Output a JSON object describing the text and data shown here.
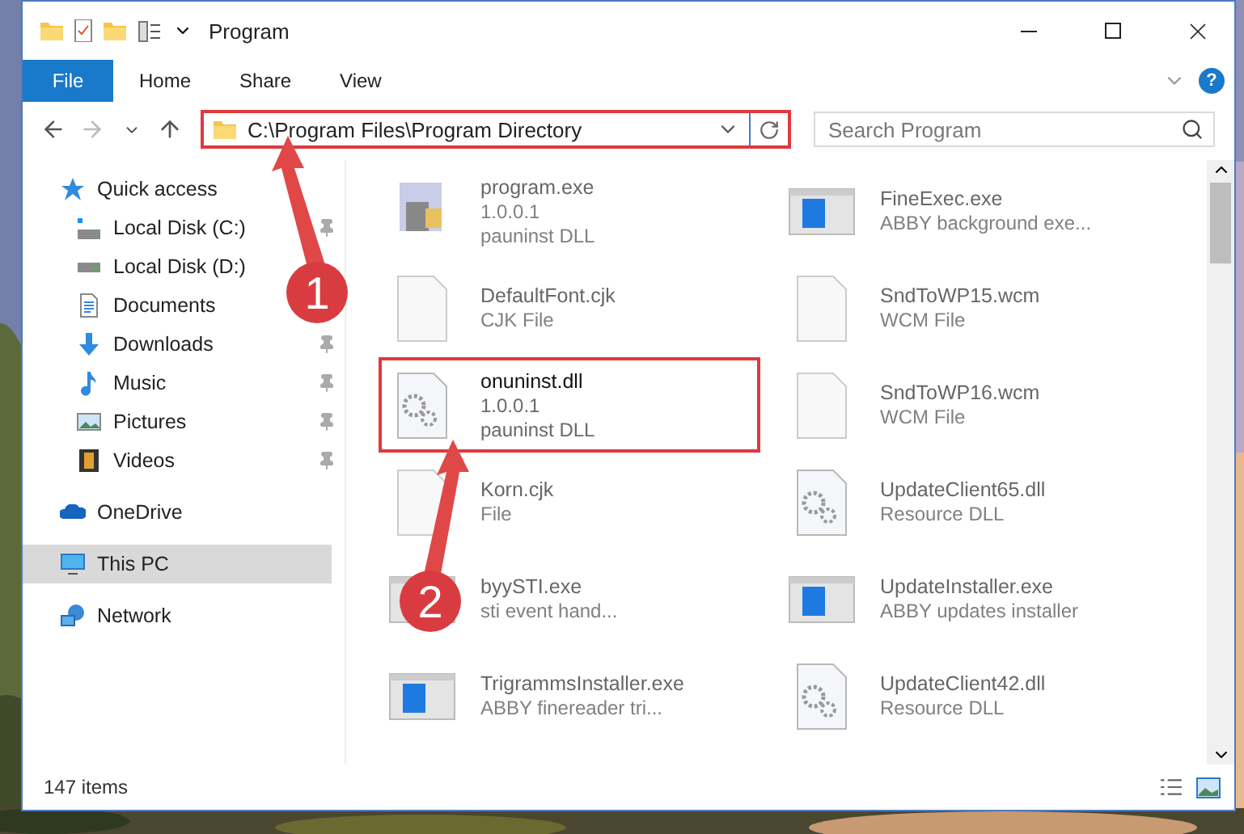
{
  "window": {
    "title": "Program"
  },
  "ribbon": {
    "file_button": "File",
    "tabs": [
      {
        "label": "Home",
        "selected": false
      },
      {
        "label": "Share",
        "selected": false
      },
      {
        "label": "View",
        "selected": false
      }
    ],
    "help": "?"
  },
  "address_bar": {
    "path": "C:\\Program Files\\Program Directory",
    "highlighted": true
  },
  "search": {
    "placeholder": "Search Program"
  },
  "sidebar": {
    "items": [
      {
        "label": "Quick access",
        "kind": "star",
        "selected": false,
        "children": [
          {
            "label": "Local Disk (C:)",
            "kind": "system",
            "pinned": true,
            "selected": false
          },
          {
            "label": "Local Disk (D:)",
            "kind": "drive",
            "selected": false
          },
          {
            "label": "Documents",
            "kind": "document",
            "selected": false
          },
          {
            "label": "Downloads",
            "kind": "download",
            "pinned": true,
            "selected": false
          },
          {
            "label": "Music",
            "kind": "music",
            "pinned": true,
            "selected": false
          },
          {
            "label": "Pictures",
            "kind": "pictures",
            "pinned": true,
            "selected": false
          },
          {
            "label": "Videos",
            "kind": "videos",
            "pinned": true,
            "selected": false
          }
        ]
      },
      {
        "label": "OneDrive",
        "kind": "cloud",
        "selected": false
      },
      {
        "label": "This PC",
        "kind": "computer",
        "selected": true
      },
      {
        "label": "Network",
        "kind": "network",
        "selected": false
      }
    ]
  },
  "files": [
    {
      "name": "program.exe",
      "lines": [
        "1.0.0.1",
        "pauninst DLL"
      ],
      "kind": "installer",
      "faded": true,
      "highlighted": false
    },
    {
      "name": "FineExec.exe",
      "lines": [
        "ABBY background exe..."
      ],
      "kind": "app",
      "faded": true,
      "highlighted": false
    },
    {
      "name": "DefaultFont.cjk",
      "lines": [
        "CJK File"
      ],
      "kind": "blank",
      "faded": true,
      "highlighted": false
    },
    {
      "name": "SndToWP15.wcm",
      "lines": [
        "WCM File"
      ],
      "kind": "blank",
      "faded": true,
      "highlighted": false
    },
    {
      "name": "onuninst.dll",
      "lines": [
        "1.0.0.1",
        "pauninst DLL"
      ],
      "kind": "dll",
      "faded": false,
      "highlighted": true
    },
    {
      "name": "SndToWP16.wcm",
      "lines": [
        "WCM File"
      ],
      "kind": "blank",
      "faded": true,
      "highlighted": false
    },
    {
      "name": "Korn.cjk",
      "lines": [
        "File"
      ],
      "kind": "blank",
      "faded": true,
      "highlighted": false
    },
    {
      "name": "UpdateClient65.dll",
      "lines": [
        "Resource DLL"
      ],
      "kind": "dll",
      "faded": true,
      "highlighted": false
    },
    {
      "name": "byySTI.exe",
      "lines": [
        "sti event hand..."
      ],
      "kind": "app",
      "faded": true,
      "highlighted": false
    },
    {
      "name": "UpdateInstaller.exe",
      "lines": [
        "ABBY updates installer"
      ],
      "kind": "app",
      "faded": true,
      "highlighted": false
    },
    {
      "name": "TrigrammsInstaller.exe",
      "lines": [
        "ABBY finereader tri..."
      ],
      "kind": "app",
      "faded": true,
      "highlighted": false
    },
    {
      "name": "UpdateClient42.dll",
      "lines": [
        "Resource DLL"
      ],
      "kind": "dll",
      "faded": true,
      "highlighted": false
    }
  ],
  "status_bar": {
    "count": "147 items"
  },
  "annotations": [
    {
      "label": "1"
    },
    {
      "label": "2"
    }
  ]
}
